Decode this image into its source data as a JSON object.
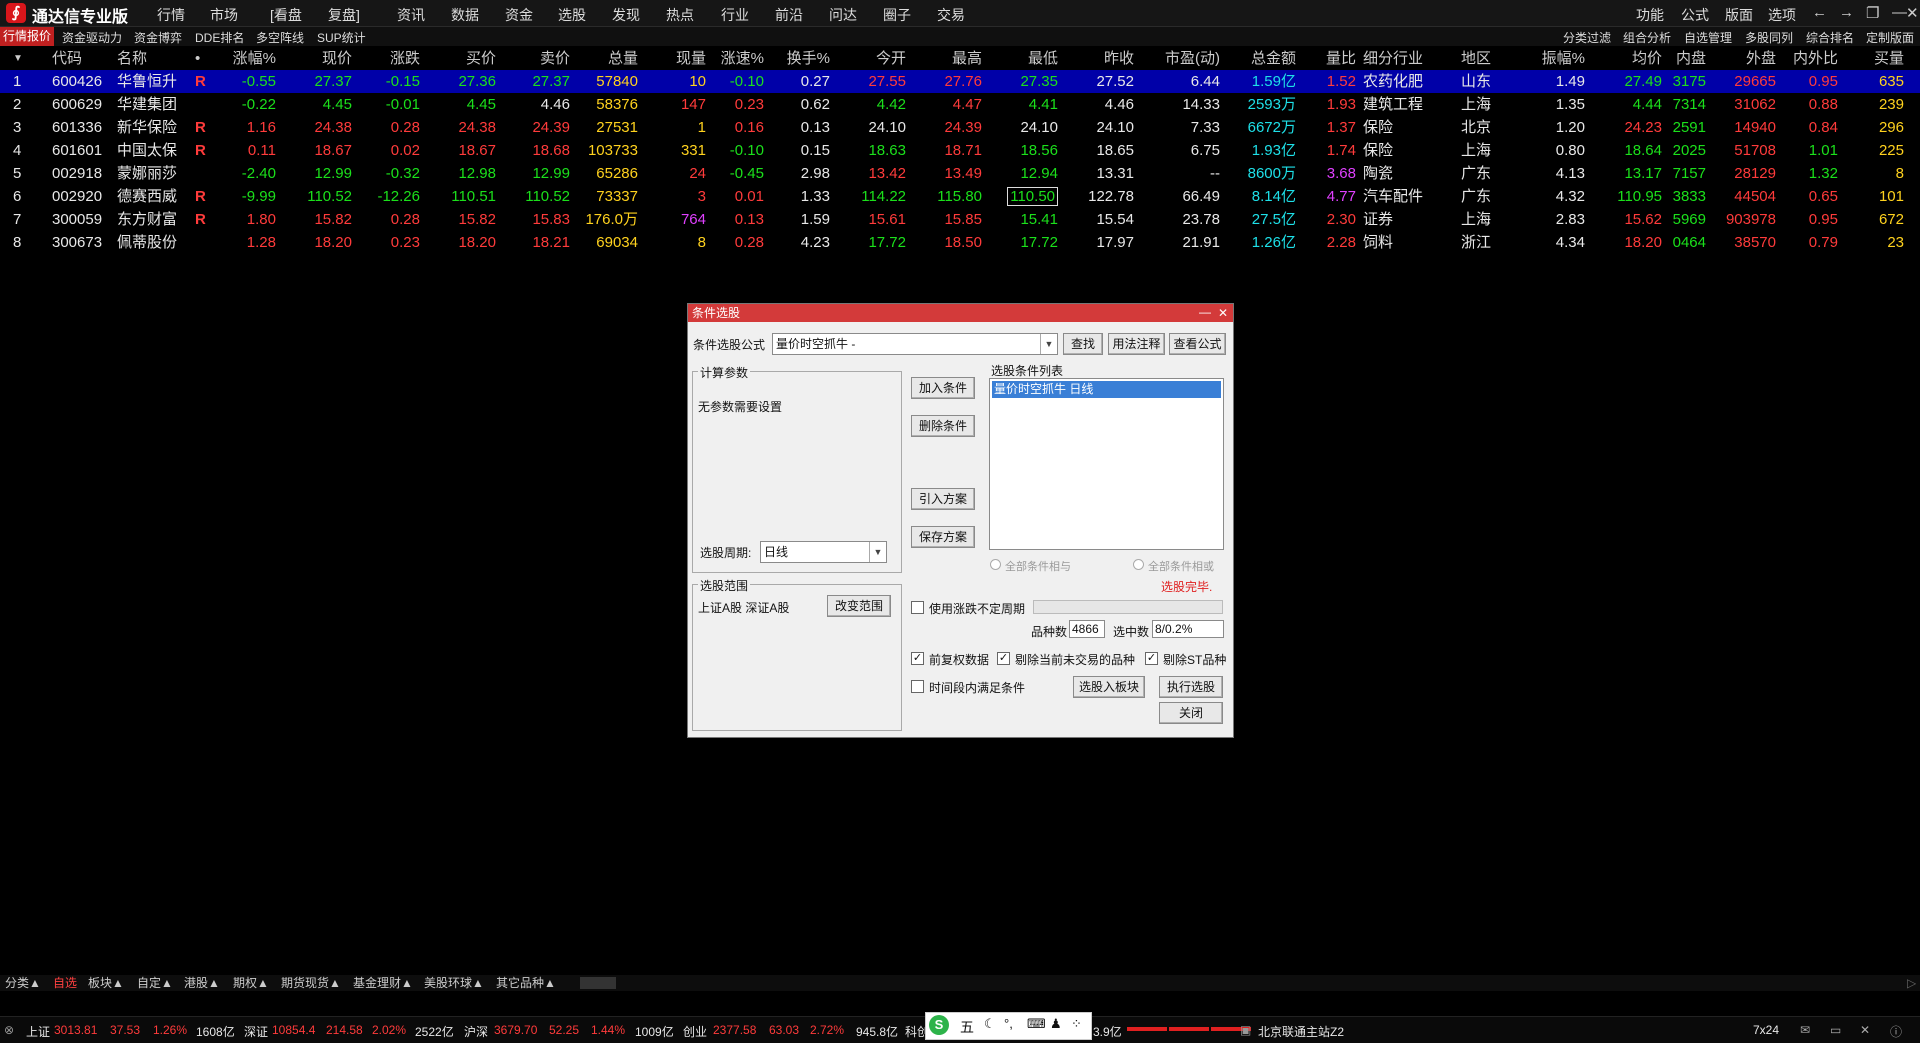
{
  "app": {
    "title": "通达信专业版",
    "logo_glyph": "∮"
  },
  "menu": [
    "行情",
    "市场",
    "[看盘",
    "复盘]",
    "资讯",
    "数据",
    "资金",
    "选股",
    "发现",
    "热点",
    "行业",
    "前沿",
    "问达",
    "圈子",
    "交易"
  ],
  "menu_right": [
    "功能",
    "公式",
    "版面",
    "选项"
  ],
  "window_icons": [
    "back-arrow-icon",
    "forward-arrow-icon",
    "restore-icon",
    "minimize-icon",
    "maximize-icon",
    "close-icon"
  ],
  "subtabs_left": [
    "行情报价",
    "资金驱动力",
    "资金博弈",
    "DDE排名",
    "多空阵线",
    "SUP统计"
  ],
  "subtabs_right": [
    "分类过滤",
    "组合分析",
    "自选管理",
    "多股同列",
    "综合排名",
    "定制版面"
  ],
  "grid": {
    "headers": [
      "",
      "代码",
      "名称",
      "•",
      "涨幅%",
      "现价",
      "涨跌",
      "买价",
      "卖价",
      "总量",
      "现量",
      "涨速%",
      "换手%",
      "今开",
      "最高",
      "最低",
      "昨收",
      "市盈(动)",
      "总金额",
      "量比",
      "细分行业",
      "地区",
      "振幅%",
      "均价",
      "内盘",
      "外盘",
      "内外比",
      "买量"
    ],
    "rows": [
      [
        "1",
        "600426",
        "华鲁恒升",
        "R",
        "-0.55",
        "27.37",
        "-0.15",
        "27.36",
        "27.37",
        "57840",
        "10",
        "-0.10",
        "0.27",
        "27.55",
        "27.76",
        "27.35",
        "27.52",
        "6.44",
        "1.59亿",
        "1.52",
        "农药化肥",
        "山东",
        "1.49",
        "27.49",
        "3175",
        "29665",
        "0.95",
        "635"
      ],
      [
        "2",
        "600629",
        "华建集团",
        "",
        "-0.22",
        "4.45",
        "-0.01",
        "4.45",
        "4.46",
        "58376",
        "147",
        "0.23",
        "0.62",
        "4.42",
        "4.47",
        "4.41",
        "4.46",
        "14.33",
        "2593万",
        "1.93",
        "建筑工程",
        "上海",
        "1.35",
        "4.44",
        "7314",
        "31062",
        "0.88",
        "239"
      ],
      [
        "3",
        "601336",
        "新华保险",
        "R",
        "1.16",
        "24.38",
        "0.28",
        "24.38",
        "24.39",
        "27531",
        "1",
        "0.16",
        "0.13",
        "24.10",
        "24.39",
        "24.10",
        "24.10",
        "7.33",
        "6672万",
        "1.37",
        "保险",
        "北京",
        "1.20",
        "24.23",
        "2591",
        "14940",
        "0.84",
        "296"
      ],
      [
        "4",
        "601601",
        "中国太保",
        "R",
        "0.11",
        "18.67",
        "0.02",
        "18.67",
        "18.68",
        "103733",
        "331",
        "-0.10",
        "0.15",
        "18.63",
        "18.71",
        "18.56",
        "18.65",
        "6.75",
        "1.93亿",
        "1.74",
        "保险",
        "上海",
        "0.80",
        "18.64",
        "2025",
        "51708",
        "1.01",
        "225"
      ],
      [
        "5",
        "002918",
        "蒙娜丽莎",
        "",
        "-2.40",
        "12.99",
        "-0.32",
        "12.98",
        "12.99",
        "65286",
        "24",
        "-0.45",
        "2.98",
        "13.42",
        "13.49",
        "12.94",
        "13.31",
        "--",
        "8600万",
        "3.68",
        "陶瓷",
        "广东",
        "4.13",
        "13.17",
        "7157",
        "28129",
        "1.32",
        "8"
      ],
      [
        "6",
        "002920",
        "德赛西威",
        "R",
        "-9.99",
        "110.52",
        "-12.26",
        "110.51",
        "110.52",
        "73337",
        "3",
        "0.01",
        "1.33",
        "114.22",
        "115.80",
        "110.50",
        "122.78",
        "66.49",
        "8.14亿",
        "4.77",
        "汽车配件",
        "广东",
        "4.32",
        "110.95",
        "3833",
        "44504",
        "0.65",
        "101"
      ],
      [
        "7",
        "300059",
        "东方财富",
        "R",
        "1.80",
        "15.82",
        "0.28",
        "15.82",
        "15.83",
        "176.0万",
        "764",
        "0.13",
        "1.59",
        "15.61",
        "15.85",
        "15.41",
        "15.54",
        "23.78",
        "27.5亿",
        "2.30",
        "证券",
        "上海",
        "2.83",
        "15.62",
        "5969",
        "903978",
        "0.95",
        "672"
      ],
      [
        "8",
        "300673",
        "佩蒂股份",
        "",
        "1.28",
        "18.20",
        "0.23",
        "18.20",
        "18.21",
        "69034",
        "8",
        "0.28",
        "4.23",
        "17.72",
        "18.50",
        "17.72",
        "17.97",
        "21.91",
        "1.26亿",
        "2.28",
        "饲料",
        "浙江",
        "4.34",
        "18.20",
        "0464",
        "38570",
        "0.79",
        "23"
      ]
    ]
  },
  "dialog": {
    "title": "条件选股",
    "formula_label": "条件选股公式",
    "formula_value": "量价时空抓牛 -",
    "btn_find": "查找",
    "btn_usage": "用法注释",
    "btn_view": "查看公式",
    "params_group": "计算参数",
    "params_text": "无参数需要设置",
    "period_label": "选股周期:",
    "period_value": "日线",
    "btn_add": "加入条件",
    "btn_delete": "删除条件",
    "btn_import": "引入方案",
    "btn_save": "保存方案",
    "cond_list_label": "选股条件列表",
    "cond_items": [
      "量价时空抓牛  日线"
    ],
    "radio_and": "全部条件相与",
    "radio_or": "全部条件相或",
    "done_text": "选股完毕.",
    "scope_group": "选股范围",
    "scope_text": "上证A股 深证A股",
    "btn_change_scope": "改变范围",
    "chk_unfixed": "使用涨跌不定周期",
    "count_label": "品种数",
    "count_value": "4866",
    "selected_label": "选中数",
    "selected_value": "8/0.2%",
    "chk_adjust": "前复权数据",
    "chk_notrade": "剔除当前未交易的品种",
    "chk_st": "剔除ST品种",
    "chk_timerange": "时间段内满足条件",
    "btn_to_block": "选股入板块",
    "btn_execute": "执行选股",
    "btn_close": "关闭"
  },
  "bottom_tabs": [
    "分类▲",
    "自选",
    "板块▲",
    "自定▲",
    "港股▲",
    "期权▲",
    "期货现货▲",
    "基金理财▲",
    "美股环球▲",
    "其它品种▲"
  ],
  "status": {
    "sh_label": "上证",
    "sh_index": "3013.81",
    "sh_chg": "37.53",
    "sh_pct": "1.26%",
    "sh_amt": "1608亿",
    "sz_label": "深证",
    "sz_index": "10854.4",
    "sz_chg": "214.58",
    "sz_pct": "2.02%",
    "sz_amt": "2522亿",
    "hs_label": "沪深",
    "hs_index": "3679.70",
    "hs_chg": "52.25",
    "hs_pct": "1.44%",
    "hs_amt": "1009亿",
    "cy_label": "创业",
    "cy_index": "2377.58",
    "cy_chg": "63.03",
    "cy_pct": "2.72%",
    "cy_amt": "945.8亿",
    "kc_label": "科创",
    "ime_label": "五",
    "tail_amt": "3.9亿",
    "server": "北京联通主站Z2",
    "service": "7x24"
  },
  "colors": {
    "up": "#ff3b3b",
    "down": "#1be01b",
    "selected_row": "#0000a8",
    "dialog_title": "#d33a3a"
  }
}
